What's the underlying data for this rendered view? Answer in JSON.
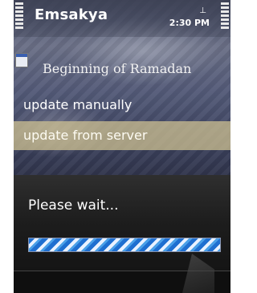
{
  "app": {
    "title": "Emsakya",
    "time": "2:30 PM"
  },
  "header": {
    "subtitle": "Beginning of Ramadan"
  },
  "menu": {
    "items": [
      {
        "label": "update manually"
      },
      {
        "label": "update from server",
        "selected": true
      }
    ]
  },
  "dialog": {
    "message": "Please wait...",
    "progress": {
      "fraction": 1.0
    }
  },
  "colors": {
    "highlight": "#cdc091",
    "progress": "#1f6fd0",
    "dialog_bg": "#1d1d1d"
  },
  "icons": {
    "calendar": "calendar-icon",
    "signal": "signal-strength-icon",
    "battery": "battery-icon",
    "network": "network-icon"
  }
}
